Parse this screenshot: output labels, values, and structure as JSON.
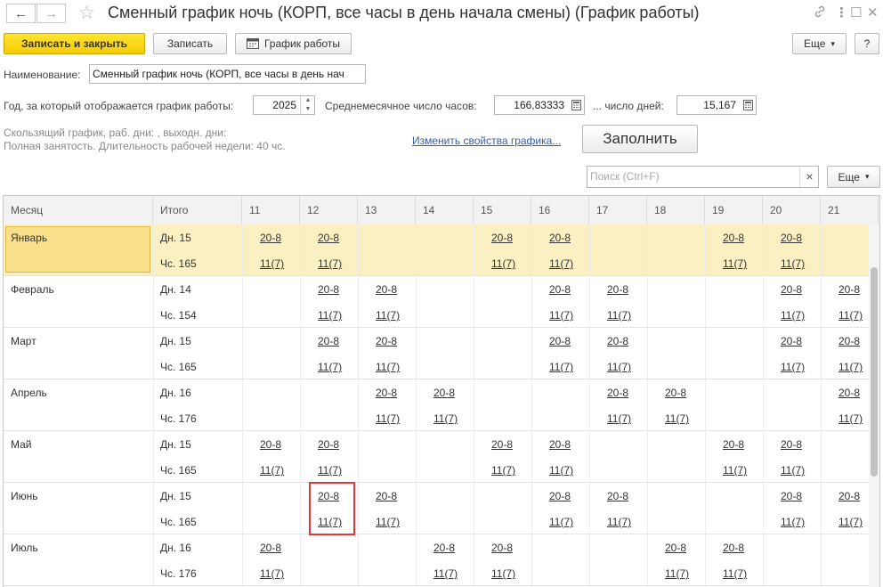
{
  "window": {
    "title": "Сменный график ночь (КОРП, все часы в день начала смены) (График работы)",
    "back_icon": "←",
    "forward_icon": "→",
    "star_icon": "☆",
    "link_icon": "🔗",
    "menu_icon": "⋮",
    "max_icon": "☐",
    "close_icon": "✕"
  },
  "toolbar": {
    "save_close": "Записать и закрыть",
    "save": "Записать",
    "schedule": "График работы",
    "more": "Еще",
    "more_arrow": "▾",
    "help": "?"
  },
  "form": {
    "name_label": "Наименование:",
    "name_value": "Сменный график ночь (КОРП, все часы в день нач",
    "year_label": "Год, за который отображается график работы:",
    "year_value": "2025",
    "avg_hours_label": "Среднемесячное число часов:",
    "avg_hours_value": "166,83333",
    "days_label": "... число дней:",
    "days_value": "15,167",
    "desc_line1": "Скользящий график, раб. дни: , выходн. дни:",
    "desc_line2": "Полная занятость. Длительность рабочей недели: 40 чс.",
    "change_link": "Изменить свойства графика...",
    "fill_button": "Заполнить"
  },
  "search": {
    "placeholder": "Поиск (Ctrl+F)",
    "clear": "×",
    "more": "Еще",
    "more_arrow": "▾"
  },
  "table": {
    "headers": [
      "Месяц",
      "Итого",
      "11",
      "12",
      "13",
      "14",
      "15",
      "16",
      "17",
      "18",
      "19",
      "20",
      "21"
    ],
    "rows": [
      {
        "month": "Январь",
        "days": "Дн. 15",
        "hours": "Чс. 165",
        "cells": [
          [
            "20-8",
            "11(7)"
          ],
          [
            "20-8",
            "11(7)"
          ],
          [
            "",
            ""
          ],
          [
            "",
            ""
          ],
          [
            "20-8",
            "11(7)"
          ],
          [
            "20-8",
            "11(7)"
          ],
          [
            "",
            ""
          ],
          [
            "",
            ""
          ],
          [
            "20-8",
            "11(7)"
          ],
          [
            "20-8",
            "11(7)"
          ],
          [
            "",
            ""
          ]
        ]
      },
      {
        "month": "Февраль",
        "days": "Дн. 14",
        "hours": "Чс. 154",
        "cells": [
          [
            "",
            ""
          ],
          [
            "20-8",
            "11(7)"
          ],
          [
            "20-8",
            "11(7)"
          ],
          [
            "",
            ""
          ],
          [
            "",
            ""
          ],
          [
            "20-8",
            "11(7)"
          ],
          [
            "20-8",
            "11(7)"
          ],
          [
            "",
            ""
          ],
          [
            "",
            ""
          ],
          [
            "20-8",
            "11(7)"
          ],
          [
            "20-8",
            "11(7)"
          ]
        ]
      },
      {
        "month": "Март",
        "days": "Дн. 15",
        "hours": "Чс. 165",
        "cells": [
          [
            "",
            ""
          ],
          [
            "20-8",
            "11(7)"
          ],
          [
            "20-8",
            "11(7)"
          ],
          [
            "",
            ""
          ],
          [
            "",
            ""
          ],
          [
            "20-8",
            "11(7)"
          ],
          [
            "20-8",
            "11(7)"
          ],
          [
            "",
            ""
          ],
          [
            "",
            ""
          ],
          [
            "20-8",
            "11(7)"
          ],
          [
            "20-8",
            "11(7)"
          ]
        ]
      },
      {
        "month": "Апрель",
        "days": "Дн. 16",
        "hours": "Чс. 176",
        "cells": [
          [
            "",
            ""
          ],
          [
            "",
            ""
          ],
          [
            "20-8",
            "11(7)"
          ],
          [
            "20-8",
            "11(7)"
          ],
          [
            "",
            ""
          ],
          [
            "",
            ""
          ],
          [
            "20-8",
            "11(7)"
          ],
          [
            "20-8",
            "11(7)"
          ],
          [
            "",
            ""
          ],
          [
            "",
            ""
          ],
          [
            "20-8",
            "11(7)"
          ]
        ]
      },
      {
        "month": "Май",
        "days": "Дн. 15",
        "hours": "Чс. 165",
        "cells": [
          [
            "20-8",
            "11(7)"
          ],
          [
            "20-8",
            "11(7)"
          ],
          [
            "",
            ""
          ],
          [
            "",
            ""
          ],
          [
            "20-8",
            "11(7)"
          ],
          [
            "20-8",
            "11(7)"
          ],
          [
            "",
            ""
          ],
          [
            "",
            ""
          ],
          [
            "20-8",
            "11(7)"
          ],
          [
            "20-8",
            "11(7)"
          ],
          [
            "",
            ""
          ]
        ]
      },
      {
        "month": "Июнь",
        "days": "Дн. 15",
        "hours": "Чс. 165",
        "cells": [
          [
            "",
            ""
          ],
          [
            "20-8",
            "11(7)"
          ],
          [
            "20-8",
            "11(7)"
          ],
          [
            "",
            ""
          ],
          [
            "",
            ""
          ],
          [
            "20-8",
            "11(7)"
          ],
          [
            "20-8",
            "11(7)"
          ],
          [
            "",
            ""
          ],
          [
            "",
            ""
          ],
          [
            "20-8",
            "11(7)"
          ],
          [
            "20-8",
            "11(7)"
          ]
        ]
      },
      {
        "month": "Июль",
        "days": "Дн. 16",
        "hours": "Чс. 176",
        "cells": [
          [
            "20-8",
            "11(7)"
          ],
          [
            "",
            ""
          ],
          [
            "",
            ""
          ],
          [
            "20-8",
            "11(7)"
          ],
          [
            "20-8",
            "11(7)"
          ],
          [
            "",
            ""
          ],
          [
            "",
            ""
          ],
          [
            "20-8",
            "11(7)"
          ],
          [
            "20-8",
            "11(7)"
          ],
          [
            "",
            ""
          ],
          [
            "",
            ""
          ]
        ]
      }
    ]
  }
}
